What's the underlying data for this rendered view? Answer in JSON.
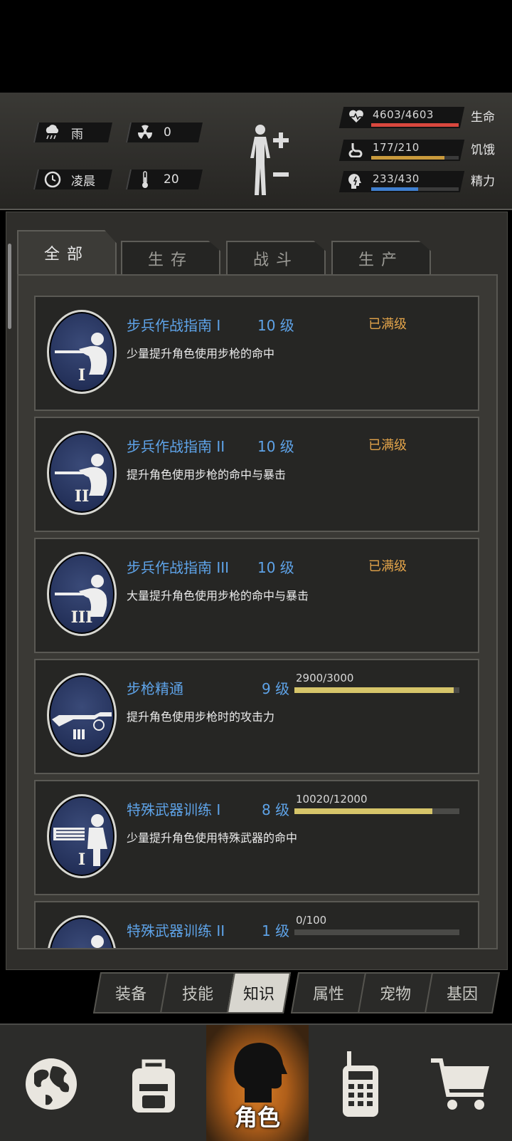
{
  "status": {
    "weather": "雨",
    "radiation": "0",
    "time_of_day": "凌晨",
    "temperature": "20",
    "stats": [
      {
        "label": "生命",
        "value": "4603/4603",
        "fill": 1.0,
        "color": "#d9473e",
        "icon": "heart-icon"
      },
      {
        "label": "饥饿",
        "value": "177/210",
        "fill": 0.84,
        "color": "#c99a3c",
        "icon": "stomach-icon"
      },
      {
        "label": "精力",
        "value": "233/430",
        "fill": 0.54,
        "color": "#3f7fcf",
        "icon": "energy-head-icon"
      }
    ]
  },
  "tabs": [
    "全部",
    "生存",
    "战斗",
    "生产"
  ],
  "skills": [
    {
      "name": "步兵作战指南 I",
      "level": "10 级",
      "status": "已满级",
      "desc": "少量提升角色使用步枪的命中",
      "roman": "I",
      "icon": "rifleman-icon"
    },
    {
      "name": "步兵作战指南 II",
      "level": "10 级",
      "status": "已满级",
      "desc": "提升角色使用步枪的命中与暴击",
      "roman": "II",
      "icon": "rifleman-icon"
    },
    {
      "name": "步兵作战指南 III",
      "level": "10 级",
      "status": "已满级",
      "desc": "大量提升角色使用步枪的命中与暴击",
      "roman": "III",
      "icon": "rifleman-icon"
    },
    {
      "name": "步枪精通",
      "level": "9 级",
      "xp": "2900/3000",
      "xp_fill": 0.967,
      "desc": "提升角色使用步枪时的攻击力",
      "roman": "",
      "icon": "rifle-icon"
    },
    {
      "name": "特殊武器训练 I",
      "level": "8 级",
      "xp": "10020/12000",
      "xp_fill": 0.835,
      "desc": "少量提升角色使用特殊武器的命中",
      "roman": "I",
      "icon": "minigun-soldier-icon"
    },
    {
      "name": "特殊武器训练 II",
      "level": "1 级",
      "xp": "0/100",
      "xp_fill": 0.0,
      "desc": "",
      "roman": "",
      "icon": "minigun-soldier-icon"
    }
  ],
  "subtabs": [
    "装备",
    "技能",
    "知识",
    "属性",
    "宠物",
    "基因"
  ],
  "active_subtab": "知识",
  "nav": {
    "items": [
      "globe-icon",
      "backpack-icon",
      "character-icon",
      "walkie-talkie-icon",
      "cart-icon"
    ],
    "active_label": "角色"
  }
}
